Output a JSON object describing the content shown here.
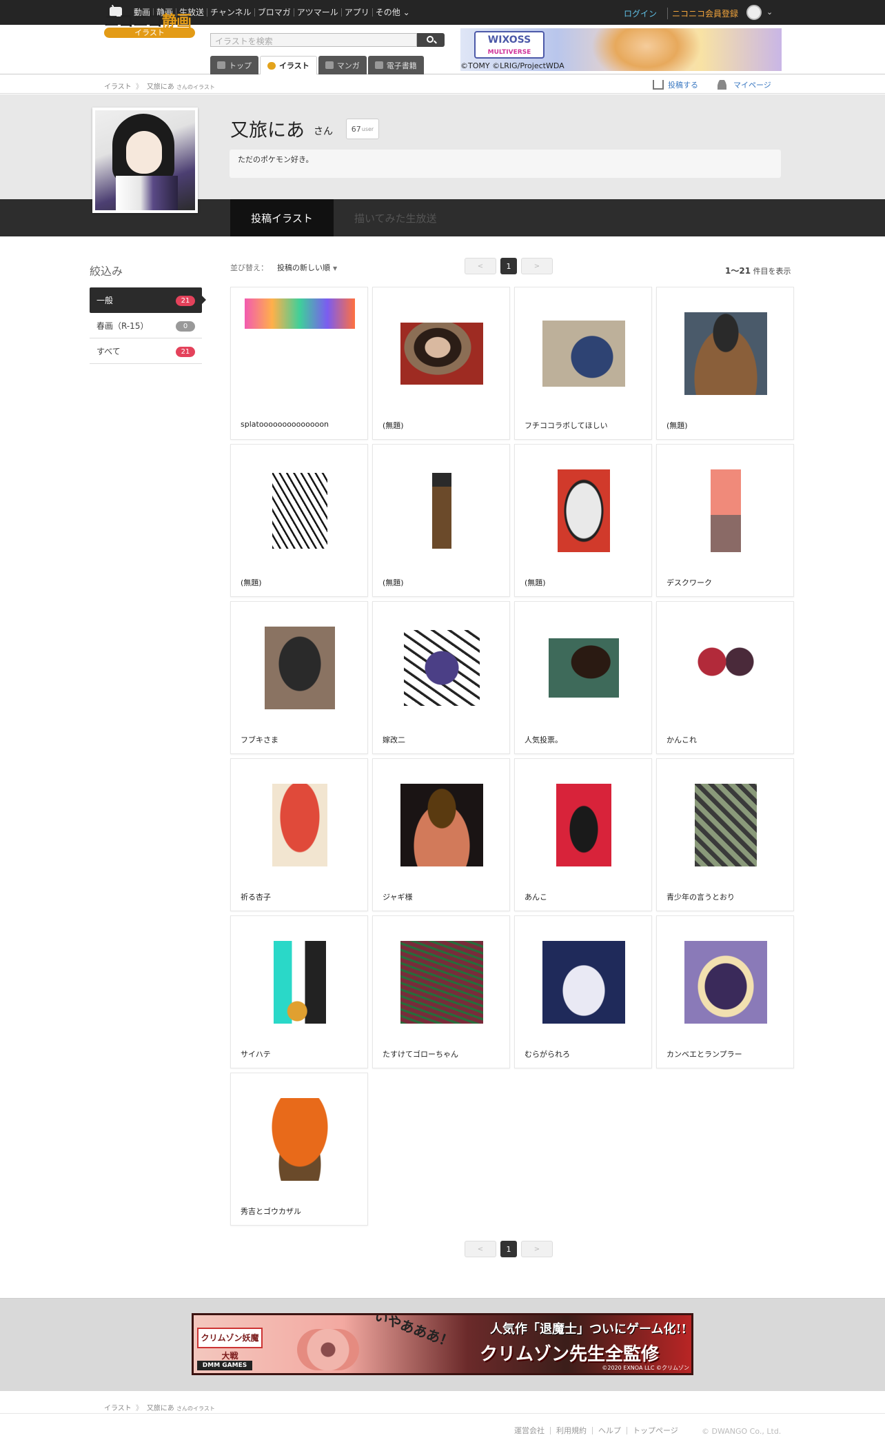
{
  "topbar": {
    "nav": [
      "動画",
      "静画",
      "生放送",
      "チャンネル",
      "ブロマガ",
      "アツマール",
      "アプリ",
      "その他"
    ],
    "login": "ログイン",
    "register": "ニコニコ会員登録"
  },
  "header": {
    "logo_main": "ニコニコ",
    "logo_accent": "静画",
    "logo_sub": "イラスト",
    "search_placeholder": "イラストを検索",
    "tabs": [
      "トップ",
      "イラスト",
      "マンガ",
      "電子書籍"
    ],
    "ad": {
      "title": "WIXOSS",
      "subtitle": "MULTIVERSE",
      "copyright": "©TOMY ©LRIG/ProjectWDA"
    }
  },
  "breadcrumb": {
    "root": "イラスト",
    "sep": "》",
    "user": "又旅にあ",
    "suffix": "さんのイラスト"
  },
  "actions": {
    "post": "投稿する",
    "mypage": "マイページ"
  },
  "profile": {
    "name": "又旅にあ",
    "suffix": "さん",
    "user_count": "67",
    "user_unit": "user",
    "bio": "ただのポケモン好き。"
  },
  "tabs": {
    "posts": "投稿イラスト",
    "live": "描いてみた生放送"
  },
  "filter": {
    "title": "絞込み",
    "items": [
      {
        "label": "一般",
        "count": "21"
      },
      {
        "label": "春画（R-15）",
        "count": "0"
      },
      {
        "label": "すべて",
        "count": "21"
      }
    ]
  },
  "sort": {
    "label": "並び替え：",
    "value": "投稿の新しい順"
  },
  "pager": {
    "prev": "<",
    "next": ">",
    "current": "1"
  },
  "count": {
    "range": "1〜21",
    "suffix": "件目を表示"
  },
  "illustrations": [
    {
      "title": "splatoooooooooooooon"
    },
    {
      "title": "(無題)"
    },
    {
      "title": "フチココラボしてほしい"
    },
    {
      "title": "(無題)"
    },
    {
      "title": "(無題)"
    },
    {
      "title": "(無題)"
    },
    {
      "title": "(無題)"
    },
    {
      "title": "デスクワーク"
    },
    {
      "title": "フブキさま"
    },
    {
      "title": "嫁改二"
    },
    {
      "title": "人気投票。"
    },
    {
      "title": "かんこれ"
    },
    {
      "title": "祈る杏子"
    },
    {
      "title": "ジャギ様"
    },
    {
      "title": "あんこ"
    },
    {
      "title": "青少年の言うとおり"
    },
    {
      "title": "サイハテ"
    },
    {
      "title": "たすけてゴローちゃん"
    },
    {
      "title": "むらがられろ"
    },
    {
      "title": "カンベエとランプラー"
    },
    {
      "title": "秀吉とゴウカザル"
    }
  ],
  "footer_ad": {
    "logo": "クリムゾン妖魔大戦",
    "brand": "DMM GAMES",
    "shout": "いやあああ！",
    "headline": "人気作「退魔士」ついにゲーム化!!",
    "big": "クリムゾン先生全監修",
    "copyright": "©2020 EXNOA LLC ©クリムゾン"
  },
  "footer": {
    "links": [
      "運営会社",
      "利用規約",
      "ヘルプ",
      "トップページ"
    ],
    "copyright": "© DWANGO Co., Ltd."
  }
}
